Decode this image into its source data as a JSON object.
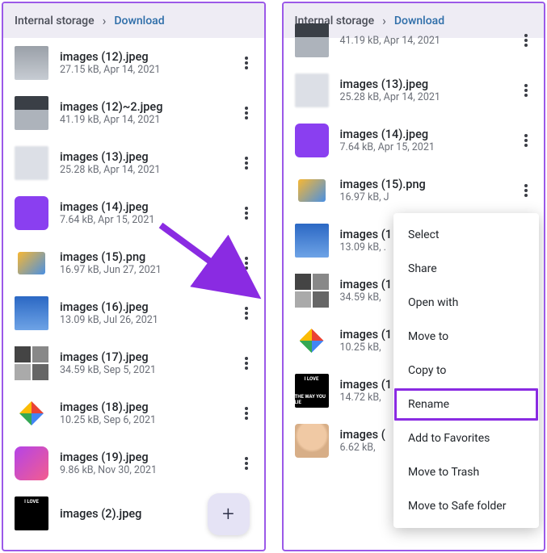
{
  "breadcrumb": {
    "root": "Internal storage",
    "current": "Download"
  },
  "left_files": [
    {
      "name": "images (12).jpeg",
      "meta": "27.15 kB, Apr 14, 2021",
      "thumb": "th-grey"
    },
    {
      "name": "images (12)~2.jpeg",
      "meta": "41.19 kB, Apr 14, 2021",
      "thumb": "th-grey2"
    },
    {
      "name": "images (13).jpeg",
      "meta": "25.28 kB, Apr 14, 2021",
      "thumb": "th-blurv"
    },
    {
      "name": "images (14).jpeg",
      "meta": "7.64 kB, Apr 15, 2021",
      "thumb": "th-purp"
    },
    {
      "name": "images (15).png",
      "meta": "16.97 kB, Jun 27, 2021",
      "thumb": "th-png"
    },
    {
      "name": "images (16).jpeg",
      "meta": "13.09 kB, Jul 26, 2021",
      "thumb": "th-blue"
    },
    {
      "name": "images (17).jpeg",
      "meta": "34.59 kB, Sep 5, 2021",
      "thumb": "th-grid"
    },
    {
      "name": "images (18).jpeg",
      "meta": "10.25 kB, Sep 6, 2021",
      "thumb": "th-photos"
    },
    {
      "name": "images (19).jpeg",
      "meta": "9.86 kB, Nov 30, 2021",
      "thumb": "th-pink"
    },
    {
      "name": "images (2).jpeg",
      "meta": "",
      "thumb": "th-meme",
      "memeTop": "I LOVE"
    }
  ],
  "right_files": [
    {
      "name": "",
      "meta": "41.19 kB, Apr 14, 2021",
      "thumb": "th-grey2"
    },
    {
      "name": "images (13).jpeg",
      "meta": "25.28 kB, Apr 14, 2021",
      "thumb": "th-blurv"
    },
    {
      "name": "images (14).jpeg",
      "meta": "7.64 kB, Apr 15, 2021",
      "thumb": "th-purp"
    },
    {
      "name": "images (15).png",
      "meta": "16.97 kB, J",
      "thumb": "th-png"
    },
    {
      "name": "images (1",
      "meta": "13.09 kB, .",
      "thumb": "th-blue"
    },
    {
      "name": "images (1",
      "meta": "34.59 kB,",
      "thumb": "th-grid"
    },
    {
      "name": "images (1",
      "meta": "10.25 kB,",
      "thumb": "th-photos"
    },
    {
      "name": "images (1",
      "meta": "14.72 kB,",
      "thumb": "th-meme",
      "memeTop": "I LOVE",
      "memeBot": "THE WAY YOU LIE"
    },
    {
      "name": "images (",
      "meta": "6.62 kB,",
      "thumb": "th-face"
    }
  ],
  "fab_glyph": "+",
  "menu": [
    {
      "label": "Select"
    },
    {
      "label": "Share"
    },
    {
      "label": "Open with"
    },
    {
      "label": "Move to"
    },
    {
      "label": "Copy to"
    },
    {
      "label": "Rename",
      "hl": true
    },
    {
      "label": "Add to Favorites"
    },
    {
      "label": "Move to Trash"
    },
    {
      "label": "Move to Safe folder"
    }
  ]
}
